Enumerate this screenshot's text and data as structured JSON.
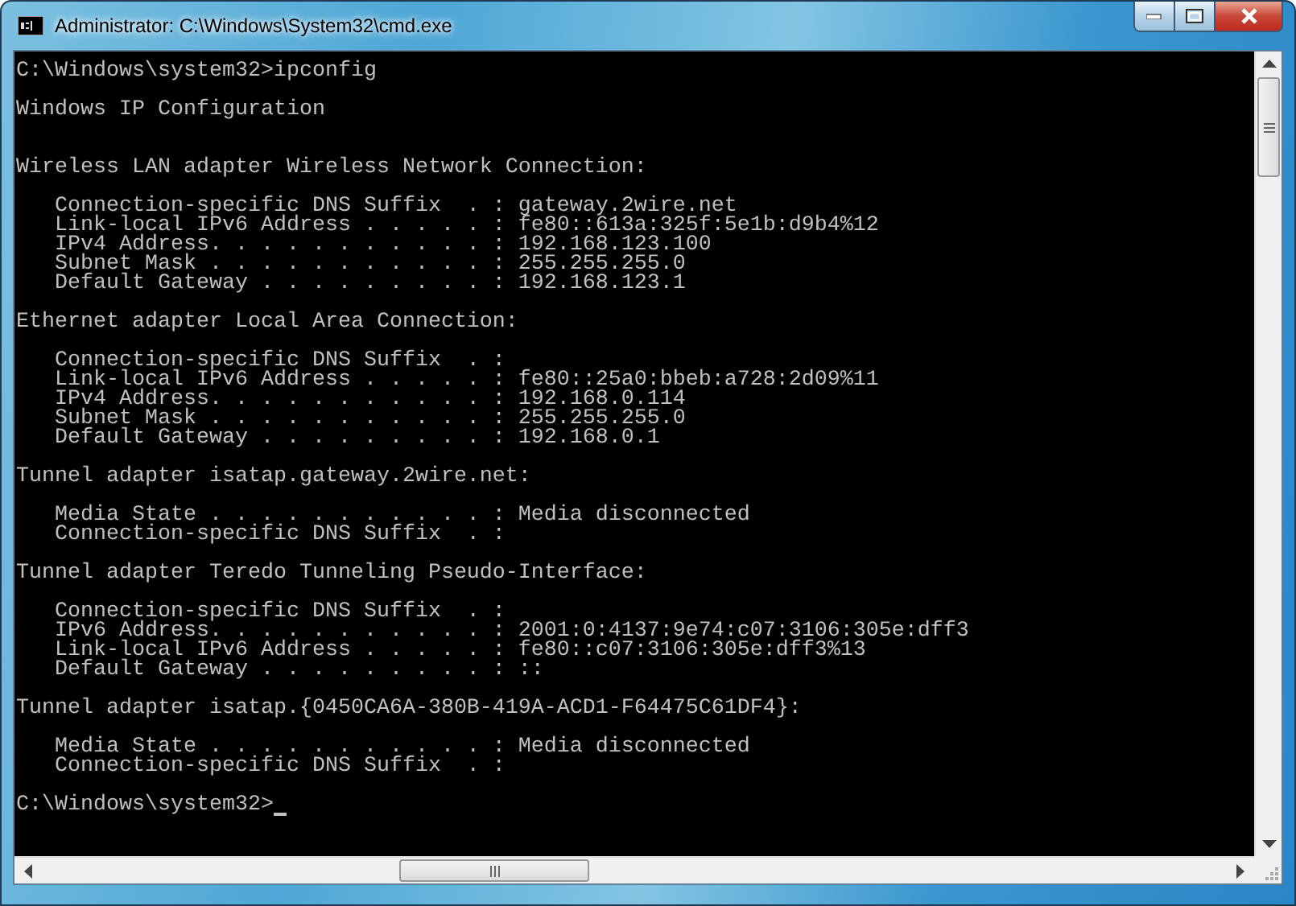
{
  "window": {
    "title": "Administrator: C:\\Windows\\System32\\cmd.exe"
  },
  "console": {
    "lines": [
      {
        "kind": "text",
        "text": "C:\\Windows\\system32>ipconfig"
      },
      {
        "kind": "blank"
      },
      {
        "kind": "text",
        "text": "Windows IP Configuration"
      },
      {
        "kind": "blank"
      },
      {
        "kind": "blank"
      },
      {
        "kind": "text",
        "text": "Wireless LAN adapter Wireless Network Connection:"
      },
      {
        "kind": "blank"
      },
      {
        "kind": "text",
        "text": "   Connection-specific DNS Suffix  . : gateway.2wire.net"
      },
      {
        "kind": "text",
        "text": "   Link-local IPv6 Address . . . . . : fe80::613a:325f:5e1b:d9b4%12"
      },
      {
        "kind": "text",
        "text": "   IPv4 Address. . . . . . . . . . . : 192.168.123.100"
      },
      {
        "kind": "text",
        "text": "   Subnet Mask . . . . . . . . . . . : 255.255.255.0"
      },
      {
        "kind": "text",
        "text": "   Default Gateway . . . . . . . . . : 192.168.123.1"
      },
      {
        "kind": "blank"
      },
      {
        "kind": "text",
        "text": "Ethernet adapter Local Area Connection:"
      },
      {
        "kind": "blank"
      },
      {
        "kind": "text",
        "text": "   Connection-specific DNS Suffix  . :"
      },
      {
        "kind": "text",
        "text": "   Link-local IPv6 Address . . . . . : fe80::25a0:bbeb:a728:2d09%11"
      },
      {
        "kind": "text",
        "text": "   IPv4 Address. . . . . . . . . . . : 192.168.0.114"
      },
      {
        "kind": "text",
        "text": "   Subnet Mask . . . . . . . . . . . : 255.255.255.0"
      },
      {
        "kind": "text",
        "text": "   Default Gateway . . . . . . . . . : 192.168.0.1"
      },
      {
        "kind": "blank"
      },
      {
        "kind": "text",
        "text": "Tunnel adapter isatap.gateway.2wire.net:"
      },
      {
        "kind": "blank"
      },
      {
        "kind": "text",
        "text": "   Media State . . . . . . . . . . . : Media disconnected"
      },
      {
        "kind": "text",
        "text": "   Connection-specific DNS Suffix  . :"
      },
      {
        "kind": "blank"
      },
      {
        "kind": "text",
        "text": "Tunnel adapter Teredo Tunneling Pseudo-Interface:"
      },
      {
        "kind": "blank"
      },
      {
        "kind": "text",
        "text": "   Connection-specific DNS Suffix  . :"
      },
      {
        "kind": "text",
        "text": "   IPv6 Address. . . . . . . . . . . : 2001:0:4137:9e74:c07:3106:305e:dff3"
      },
      {
        "kind": "text",
        "text": "   Link-local IPv6 Address . . . . . : fe80::c07:3106:305e:dff3%13"
      },
      {
        "kind": "text",
        "text": "   Default Gateway . . . . . . . . . : ::"
      },
      {
        "kind": "blank"
      },
      {
        "kind": "text",
        "text": "Tunnel adapter isatap.{0450CA6A-380B-419A-ACD1-F64475C61DF4}:"
      },
      {
        "kind": "blank"
      },
      {
        "kind": "text",
        "text": "   Media State . . . . . . . . . . . : Media disconnected"
      },
      {
        "kind": "text",
        "text": "   Connection-specific DNS Suffix  . :"
      },
      {
        "kind": "blank"
      },
      {
        "kind": "prompt",
        "text": "C:\\Windows\\system32>"
      }
    ]
  }
}
